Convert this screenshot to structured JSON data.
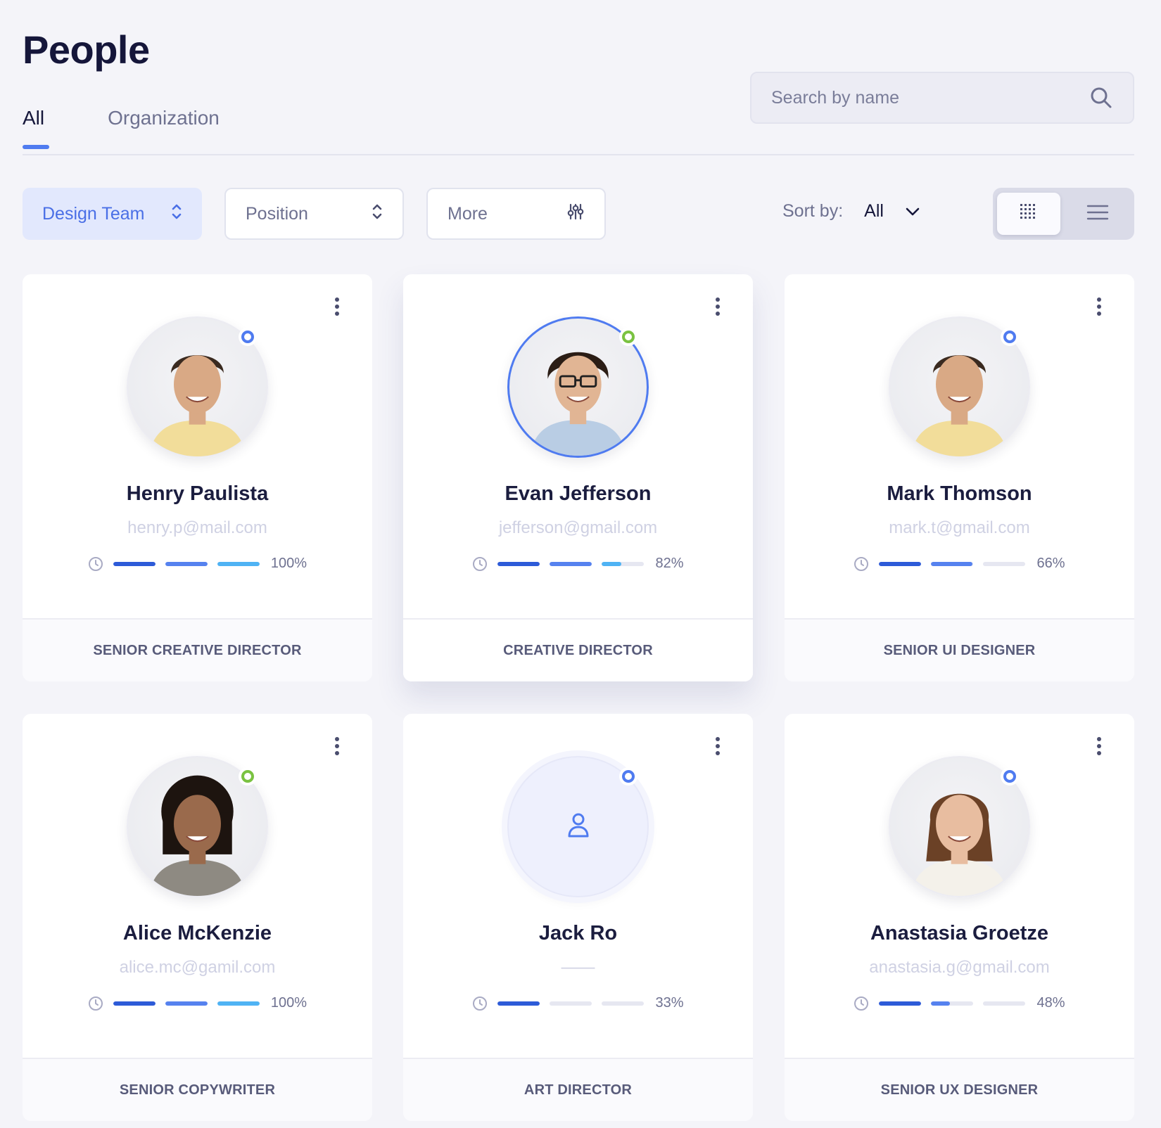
{
  "page": {
    "title": "People"
  },
  "tabs": [
    {
      "label": "All",
      "active": true
    },
    {
      "label": "Organization",
      "active": false
    }
  ],
  "search": {
    "placeholder": "Search by name",
    "value": ""
  },
  "filters": {
    "team": "Design Team",
    "position": "Position",
    "more": "More"
  },
  "sort": {
    "label": "Sort by:",
    "value": "All"
  },
  "view": {
    "active": "grid"
  },
  "colors": {
    "accent": "#4f7bf0",
    "online": "#7ac241",
    "away": "#4f7bf0"
  },
  "people": [
    {
      "name": "Henry Paulista",
      "email": "henry.p@mail.com",
      "progress": 100,
      "percent_label": "100%",
      "role": "SENIOR CREATIVE DIRECTOR",
      "status": "away",
      "avatar": "photo-man-smiling"
    },
    {
      "name": "Evan Jefferson",
      "email": "jefferson@gmail.com",
      "progress": 82,
      "percent_label": "82%",
      "role": "CREATIVE DIRECTOR",
      "status": "online",
      "avatar": "photo-man-glasses"
    },
    {
      "name": "Mark Thomson",
      "email": "mark.t@gmail.com",
      "progress": 66,
      "percent_label": "66%",
      "role": "SENIOR UI DESIGNER",
      "status": "away",
      "avatar": "photo-man-smiling"
    },
    {
      "name": "Alice McKenzie",
      "email": "alice.mc@gamil.com",
      "progress": 100,
      "percent_label": "100%",
      "role": "SENIOR COPYWRITER",
      "status": "online",
      "avatar": "photo-woman-curly"
    },
    {
      "name": "Jack Ro",
      "email": "——",
      "progress": 33,
      "percent_label": "33%",
      "role": "ART DIRECTOR",
      "status": "away",
      "avatar": "user-icon"
    },
    {
      "name": "Anastasia Groetze",
      "email": "anastasia.g@gmail.com",
      "progress": 48,
      "percent_label": "48%",
      "role": "SENIOR UX DESIGNER",
      "status": "away",
      "avatar": "photo-woman-smiling"
    }
  ]
}
